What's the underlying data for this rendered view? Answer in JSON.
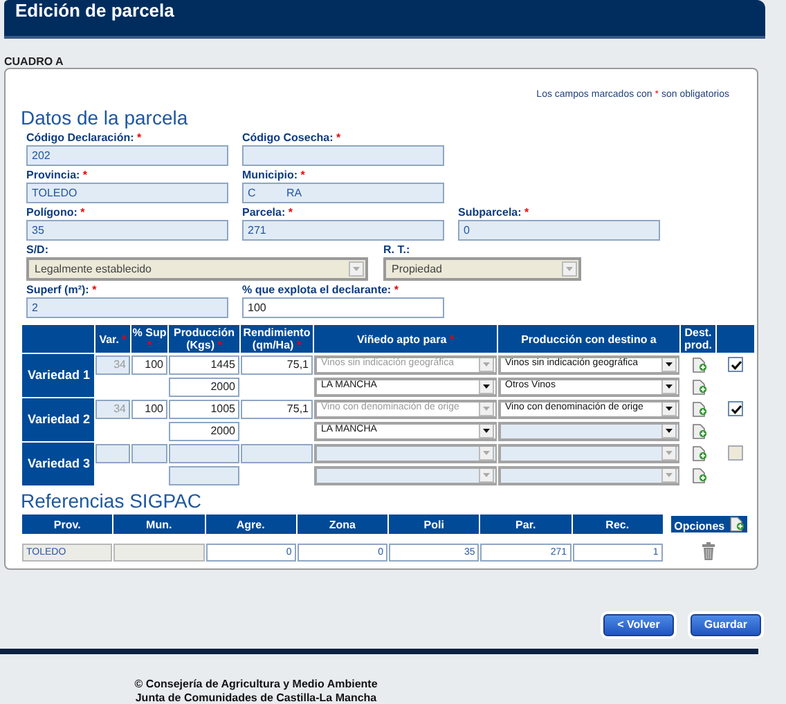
{
  "header": {
    "title": "Edición de parcela"
  },
  "section_label": "CUADRO A",
  "required_note": {
    "text_before": "Los campos marcados con",
    "mark": "*",
    "text_after": "son obligatorios"
  },
  "parcel_title": "Datos de la parcela",
  "form_rows": [
    [
      {
        "label": "Código Declaración:",
        "mark": "*",
        "kind": "input",
        "value": "202",
        "disabled": true
      },
      {
        "label": "Código Cosecha:",
        "mark": "*",
        "kind": "input",
        "disabled": true
      }
    ],
    [
      {
        "label": "Provincia:",
        "mark": "*",
        "kind": "input",
        "value": "TOLEDO",
        "disabled": true
      },
      {
        "label": "Municipio:",
        "mark": "*",
        "kind": "input",
        "value": "C          RA",
        "disabled": true
      }
    ],
    [
      {
        "label": "Polígono:",
        "mark": "*",
        "kind": "input",
        "value": "35",
        "disabled": true
      },
      {
        "label": "Parcela:",
        "mark": "*",
        "kind": "input",
        "value": "271",
        "disabled": true
      },
      {
        "label": "Subparcela:",
        "mark": "*",
        "kind": "input",
        "value": "0",
        "disabled": true
      }
    ],
    [
      {
        "label": "S/D:",
        "kind": "select",
        "value": "Legalmente establecido",
        "disabled": true
      },
      {
        "label": "R. T.:",
        "kind": "select",
        "value": "Propiedad",
        "disabled": true
      }
    ],
    [
      {
        "label": "Superf (m²):",
        "mark": "*",
        "kind": "input",
        "value": "2",
        "disabled": true
      },
      {
        "label": "% que explota el declarante:",
        "mark": "*",
        "kind": "input",
        "value": "100",
        "disabled": false
      }
    ]
  ],
  "variety_table": {
    "columns": [
      {
        "label": "Var.",
        "mark": "*"
      },
      {
        "label": "% Sup",
        "mark": "*"
      },
      {
        "label": "Producción (Kgs)",
        "mark": "*"
      },
      {
        "label": "Rendimiento (qm/Ha)",
        "mark": "*"
      },
      {
        "label": "Viñedo apto para",
        "mark": "*"
      },
      {
        "label": "Producción con destino a"
      },
      {
        "label": "Dest. prod."
      }
    ],
    "rows": [
      {
        "label": "Variedad 1",
        "var": {
          "value": "34",
          "disabled": true
        },
        "sup": {
          "value": "100",
          "disabled": false
        },
        "produccion": [
          {
            "value": "1445",
            "disabled": false
          },
          {
            "value": "2000",
            "disabled": false
          }
        ],
        "rendimiento": {
          "value": "75,1",
          "disabled": false
        },
        "vinedo": [
          {
            "value": "Vinos sin indicación geográfica",
            "disabled": true
          },
          {
            "value": "LA MANCHA",
            "disabled": false
          }
        ],
        "destino": [
          {
            "value": "Vinos sin indicación geográfica",
            "disabled": false
          },
          {
            "value": "Otros Vinos",
            "disabled": false
          }
        ],
        "checkbox": {
          "checked": true,
          "disabled": false
        }
      },
      {
        "label": "Variedad 2",
        "var": {
          "value": "34",
          "disabled": true
        },
        "sup": {
          "value": "100",
          "disabled": false
        },
        "produccion": [
          {
            "value": "1005",
            "disabled": false
          },
          {
            "value": "2000",
            "disabled": false
          }
        ],
        "rendimiento": {
          "value": "75,1",
          "disabled": false
        },
        "vinedo": [
          {
            "value": "Vino con denominación de orige",
            "disabled": true
          },
          {
            "value": "LA MANCHA",
            "disabled": false
          }
        ],
        "destino": [
          {
            "value": "Vino con denominación de orige",
            "disabled": false
          },
          {
            "disabled": false
          }
        ],
        "checkbox": {
          "checked": true,
          "disabled": false
        }
      },
      {
        "label": "Variedad 3",
        "var": {
          "disabled": true
        },
        "sup": {
          "disabled": true
        },
        "produccion": [
          {
            "disabled": true
          },
          {
            "disabled": true
          }
        ],
        "rendimiento": {
          "disabled": true
        },
        "vinedo": [
          {
            "disabled": true
          },
          {
            "disabled": true
          }
        ],
        "destino": [
          {
            "disabled": true
          },
          {
            "disabled": true
          }
        ],
        "checkbox": {
          "checked": false,
          "disabled": true
        }
      }
    ]
  },
  "sigpac_title": "Referencias SIGPAC",
  "sigpac_table": {
    "columns": [
      "Prov.",
      "Mun.",
      "Agre.",
      "Zona",
      "Poli",
      "Par.",
      "Rec.",
      "Opciones"
    ],
    "rows": [
      {
        "cells": [
          {
            "value": "TOLEDO",
            "disabled": true
          },
          {
            "disabled": true
          },
          {
            "value": "0",
            "disabled": false
          },
          {
            "value": "0",
            "disabled": false
          },
          {
            "value": "35",
            "disabled": false
          },
          {
            "value": "271",
            "disabled": false
          },
          {
            "value": "1",
            "disabled": false
          }
        ]
      }
    ]
  },
  "buttons": [
    "< Volver",
    "Guardar"
  ],
  "footer": [
    "© Consejería de Agricultura y Medio Ambiente",
    "Junta de Comunidades de Castilla-La Mancha"
  ]
}
